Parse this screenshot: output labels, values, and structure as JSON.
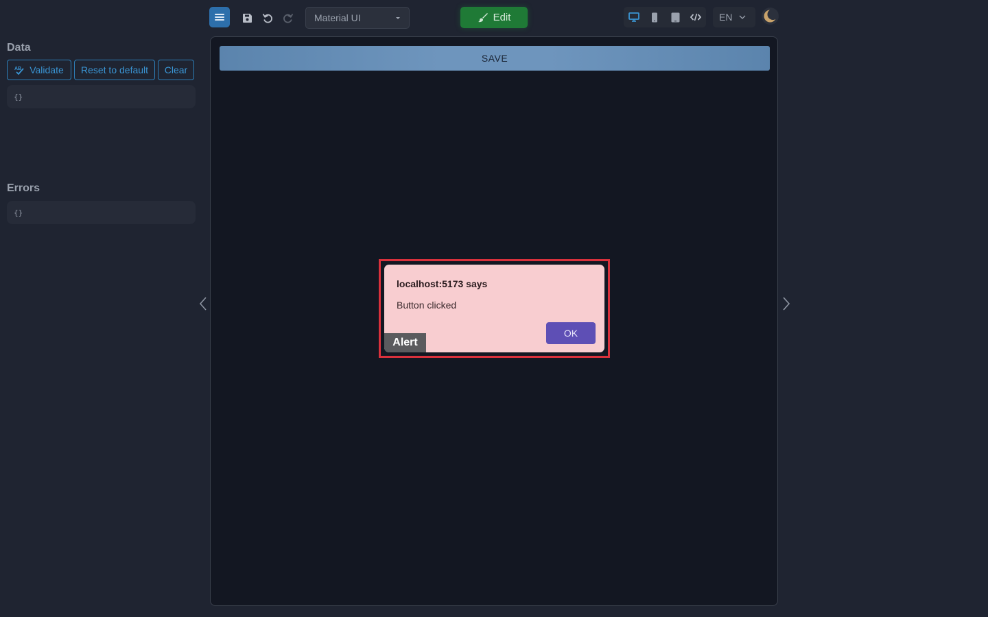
{
  "toolbar": {
    "ui_library": "Material UI",
    "edit_label": "Edit",
    "language": "EN",
    "icons": {
      "menu": "menu-icon",
      "save": "save-icon",
      "undo": "undo-icon",
      "redo": "redo-icon",
      "desktop": "desktop-icon",
      "phone": "phone-icon",
      "tablet": "tablet-icon",
      "code": "code-icon",
      "theme": "moon-icon"
    },
    "colors": {
      "menu_active": "#2d6fab",
      "edit_green": "#1f7a36"
    }
  },
  "data_panel": {
    "title": "Data",
    "validate_label": "Validate",
    "reset_label": "Reset to default",
    "clear_label": "Clear",
    "content": "{}"
  },
  "errors_panel": {
    "title": "Errors",
    "content": "{}"
  },
  "canvas": {
    "save_button_label": "SAVE"
  },
  "alert": {
    "origin": "localhost:5173 says",
    "message": "Button clicked",
    "ok_label": "OK",
    "tag": "Alert",
    "highlight_color": "#d9313c"
  }
}
